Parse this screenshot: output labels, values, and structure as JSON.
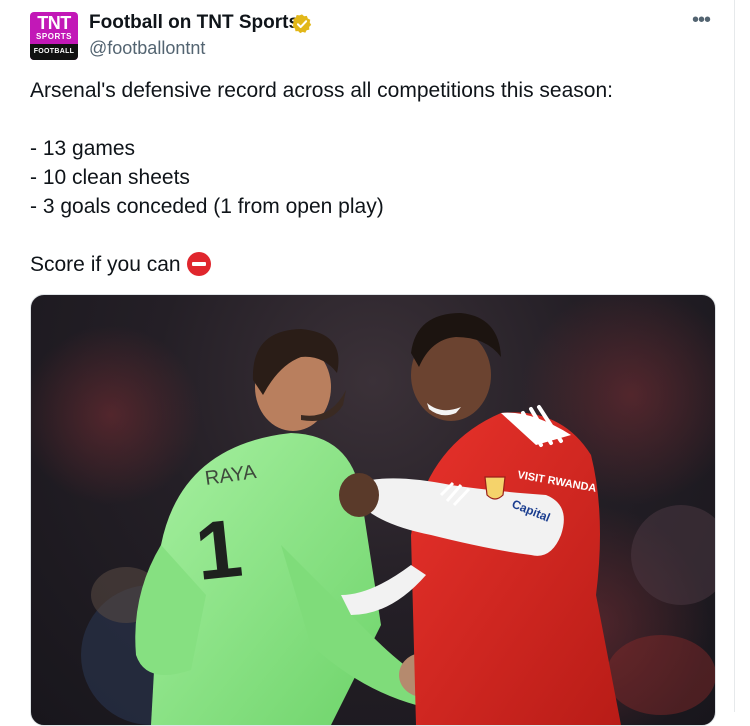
{
  "author": {
    "display_name": "Football on TNT Sports",
    "handle": "@footballontnt",
    "avatar": {
      "line1": "TNT",
      "line2": "SPORTS",
      "line3": "FOOTBALL"
    },
    "verified_icon": "verified-badge-icon"
  },
  "more_label": "•••",
  "tweet": {
    "intro": "Arsenal's defensive record across all competitions this season:",
    "stats": [
      "- 13 games",
      "- 10 clean sheets",
      "- 3 goals conceded (1 from open play)"
    ],
    "closing": "Score if you can",
    "closing_emoji": "no-entry-icon"
  },
  "photo": {
    "keeper_name": "RAYA",
    "keeper_number": "1",
    "sponsor_1": "VISIT RWANDA",
    "sponsor_2": "Capital"
  },
  "colors": {
    "brand": "#c218b7",
    "text": "#0f1419",
    "secondary": "#536471",
    "arsenal_red": "#d7261e",
    "keeper_green": "#8fe38a"
  }
}
